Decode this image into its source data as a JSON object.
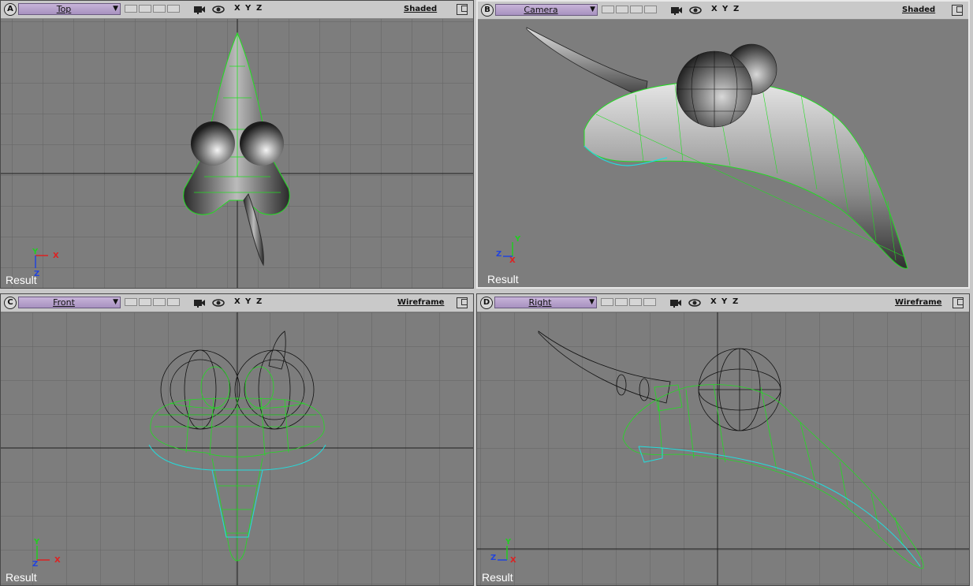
{
  "viewports": [
    {
      "id": "A",
      "view": "Top",
      "mode": "Shaded",
      "axes": [
        "X",
        "Y",
        "Z"
      ],
      "result": "Result",
      "gizmo": [
        "Y",
        "X",
        "Z"
      ]
    },
    {
      "id": "B",
      "view": "Camera",
      "mode": "Shaded",
      "axes": [
        "X",
        "Y",
        "Z"
      ],
      "result": "Result",
      "gizmo": [
        "Y",
        "Z",
        "X"
      ]
    },
    {
      "id": "C",
      "view": "Front",
      "mode": "Wireframe",
      "axes": [
        "X",
        "Y",
        "Z"
      ],
      "result": "Result",
      "gizmo": [
        "Y",
        "Z",
        "X"
      ]
    },
    {
      "id": "D",
      "view": "Right",
      "mode": "Wireframe",
      "axes": [
        "X",
        "Y",
        "Z"
      ],
      "result": "Result",
      "gizmo": [
        "Y",
        "Z",
        "X"
      ]
    }
  ],
  "colors": {
    "viewport_bg": "#7d7d7d",
    "grid": "#5f5f5f",
    "axis_line": "#1e1e1e",
    "selection_wire": "#22dd22",
    "highlight_wire": "#22dddd",
    "view_dropdown": "#b8a4cc",
    "gizmo_x": "#dd2222",
    "gizmo_y": "#22cc22",
    "gizmo_z": "#2244dd"
  },
  "icons": [
    "camera-icon",
    "eye-icon",
    "maximize-icon",
    "dropdown-arrow-icon"
  ]
}
